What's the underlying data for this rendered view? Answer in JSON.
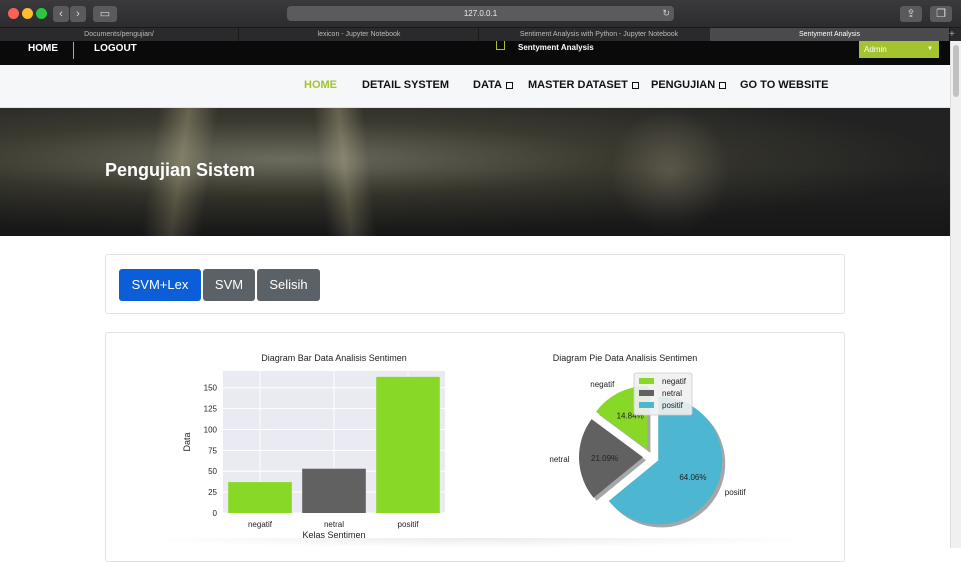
{
  "browser": {
    "url": "127.0.0.1",
    "tabs": [
      {
        "label": "Documents/pengujian/"
      },
      {
        "label": "lexicon - Jupyter Notebook"
      },
      {
        "label": "Sentiment Analysis with Python - Jupyter Notebook"
      },
      {
        "label": "Sentyment Analysis"
      }
    ]
  },
  "topbar": {
    "home": "HOME",
    "logout": "LOGOUT",
    "brand": "Sentyment Analysis",
    "admin": "Admin"
  },
  "nav": {
    "items": [
      {
        "label": "HOME",
        "has_dropdown": false,
        "active": true
      },
      {
        "label": "DETAIL SYSTEM",
        "has_dropdown": false,
        "active": false
      },
      {
        "label": "DATA",
        "has_dropdown": true,
        "active": false
      },
      {
        "label": "MASTER DATASET",
        "has_dropdown": true,
        "active": false
      },
      {
        "label": "PENGUJIAN",
        "has_dropdown": true,
        "active": false
      },
      {
        "label": "GO TO WEBSITE",
        "has_dropdown": false,
        "active": false
      }
    ]
  },
  "hero": {
    "title": "Pengujian Sistem"
  },
  "tabs": {
    "svm_lex": "SVM+Lex",
    "svm": "SVM",
    "selisih": "Selisih"
  },
  "colors": {
    "accent": "#a3c42e",
    "primary": "#0b5ed7",
    "secondary": "#5a6268",
    "negatif": "#88d828",
    "netral": "#616161",
    "positif": "#4db6d0"
  },
  "chart_data": [
    {
      "type": "bar",
      "title": "Diagram Bar Data Analisis Sentimen",
      "xlabel": "Kelas Sentimen",
      "ylabel": "Data",
      "categories": [
        "negatif",
        "netral",
        "positif"
      ],
      "values": [
        37,
        53,
        163
      ],
      "ylim": [
        0,
        170
      ],
      "yticks": [
        0,
        25,
        50,
        75,
        100,
        125,
        150
      ],
      "grid": true
    },
    {
      "type": "pie",
      "title": "Diagram Pie Data Analisis Sentimen",
      "slices": [
        {
          "label": "negatif",
          "value": 14.84,
          "text": "14.84%"
        },
        {
          "label": "netral",
          "value": 21.09,
          "text": "21.09%"
        },
        {
          "label": "positif",
          "value": 64.06,
          "text": "64.06%"
        }
      ],
      "legend_position": "top-right"
    }
  ]
}
